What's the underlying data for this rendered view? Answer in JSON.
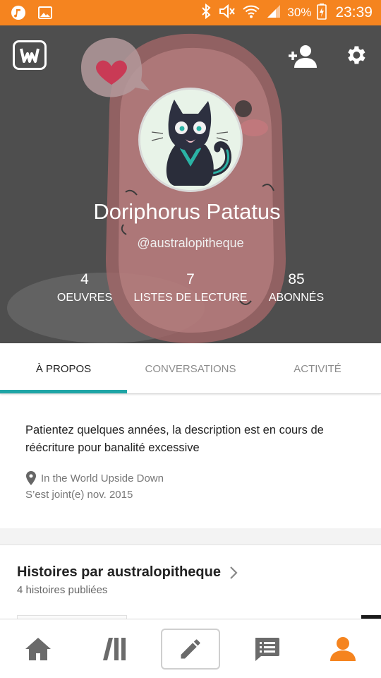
{
  "status_bar": {
    "battery": "30%",
    "time": "23:39",
    "background_color": "#f5841f",
    "icons": [
      "music-icon",
      "image-icon",
      "bluetooth-icon",
      "mute-icon",
      "wifi-icon",
      "signal-icon",
      "battery-charging-icon"
    ]
  },
  "profile": {
    "display_name": "Doriphorus Patatus",
    "username": "@australopitheque",
    "stats": [
      {
        "value": "4",
        "label": "OEUVRES"
      },
      {
        "value": "7",
        "label": "LISTES DE LECTURE"
      },
      {
        "value": "85",
        "label": "ABONNÉS"
      }
    ]
  },
  "tabs": [
    {
      "label": "À PROPOS",
      "active": true
    },
    {
      "label": "CONVERSATIONS",
      "active": false
    },
    {
      "label": "ACTIVITÉ",
      "active": false
    }
  ],
  "about": {
    "description": "Patientez quelques années, la description est en cours de réécriture pour banalité excessive",
    "location": "In the World Upside Down",
    "joined": "S’est joint(e) nov. 2015"
  },
  "stories": {
    "title": "Histoires par australopitheque",
    "count": "4 histoires publiées"
  },
  "bottom_nav": [
    "home-icon",
    "library-icon",
    "write-icon",
    "messages-icon",
    "profile-icon"
  ],
  "colors": {
    "accent_orange": "#f5841f",
    "tab_indicator": "#1fa5a6",
    "header_bg": "#4e4e4e"
  }
}
